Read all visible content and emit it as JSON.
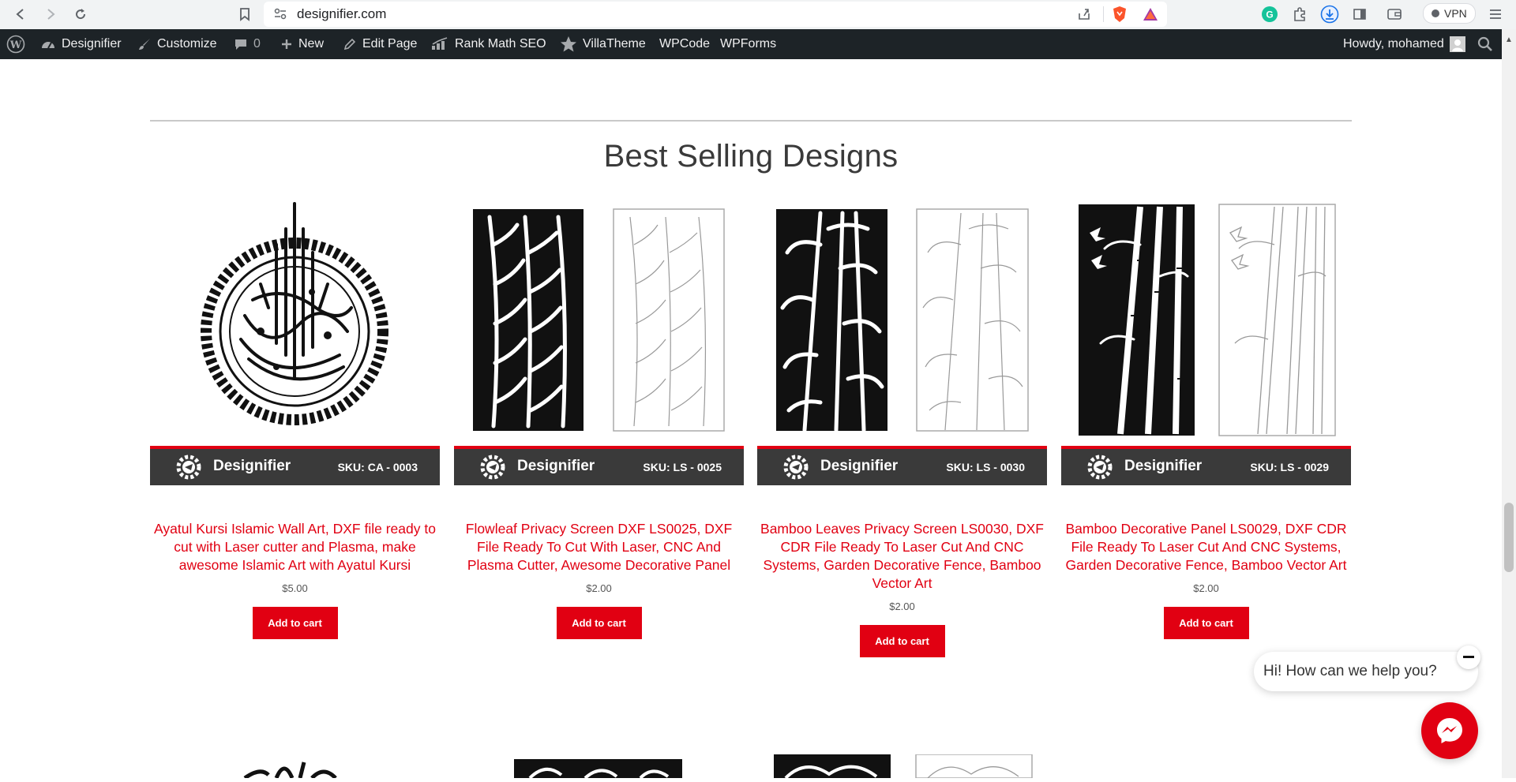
{
  "browser": {
    "url": "designifier.com",
    "vpn_label": "VPN"
  },
  "admin_bar": {
    "site_name": "Designifier",
    "customize": "Customize",
    "comments_count": "0",
    "new": "New",
    "edit_page": "Edit Page",
    "rank_math": "Rank Math SEO",
    "villatheme": "VillaTheme",
    "wpcode": "WPCode",
    "wpforms": "WPForms",
    "howdy": "Howdy, mohamed"
  },
  "section": {
    "title": "Best Selling Designs"
  },
  "products": [
    {
      "brand": "Designifier",
      "sku": "SKU: CA - 0003",
      "title": "Ayatul Kursi Islamic Wall Art, DXF file ready to cut with Laser cutter and Plasma, make awesome Islamic Art with Ayatul Kursi",
      "price": "$5.00",
      "button": "Add to cart"
    },
    {
      "brand": "Designifier",
      "sku": "SKU: LS - 0025",
      "title": "Flowleaf Privacy Screen DXF LS0025, DXF File Ready To Cut With Laser, CNC And Plasma Cutter, Awesome Decorative Panel",
      "price": "$2.00",
      "button": "Add to cart"
    },
    {
      "brand": "Designifier",
      "sku": "SKU: LS - 0030",
      "title": "Bamboo Leaves Privacy Screen LS0030, DXF CDR File Ready To Laser Cut And CNC Systems, Garden Decorative Fence, Bamboo Vector Art",
      "price": "$2.00",
      "button": "Add to cart"
    },
    {
      "brand": "Designifier",
      "sku": "SKU: LS - 0029",
      "title": "Bamboo Decorative Panel LS0029, DXF CDR File Ready To Laser Cut And CNC Systems, Garden Decorative Fence, Bamboo Vector Art",
      "price": "$2.00",
      "button": "Add to cart"
    }
  ],
  "chat": {
    "greeting": "Hi! How can we help you?"
  },
  "colors": {
    "accent": "#e10012",
    "admin_bar": "#1d2327",
    "banner": "#3a3a3a"
  }
}
